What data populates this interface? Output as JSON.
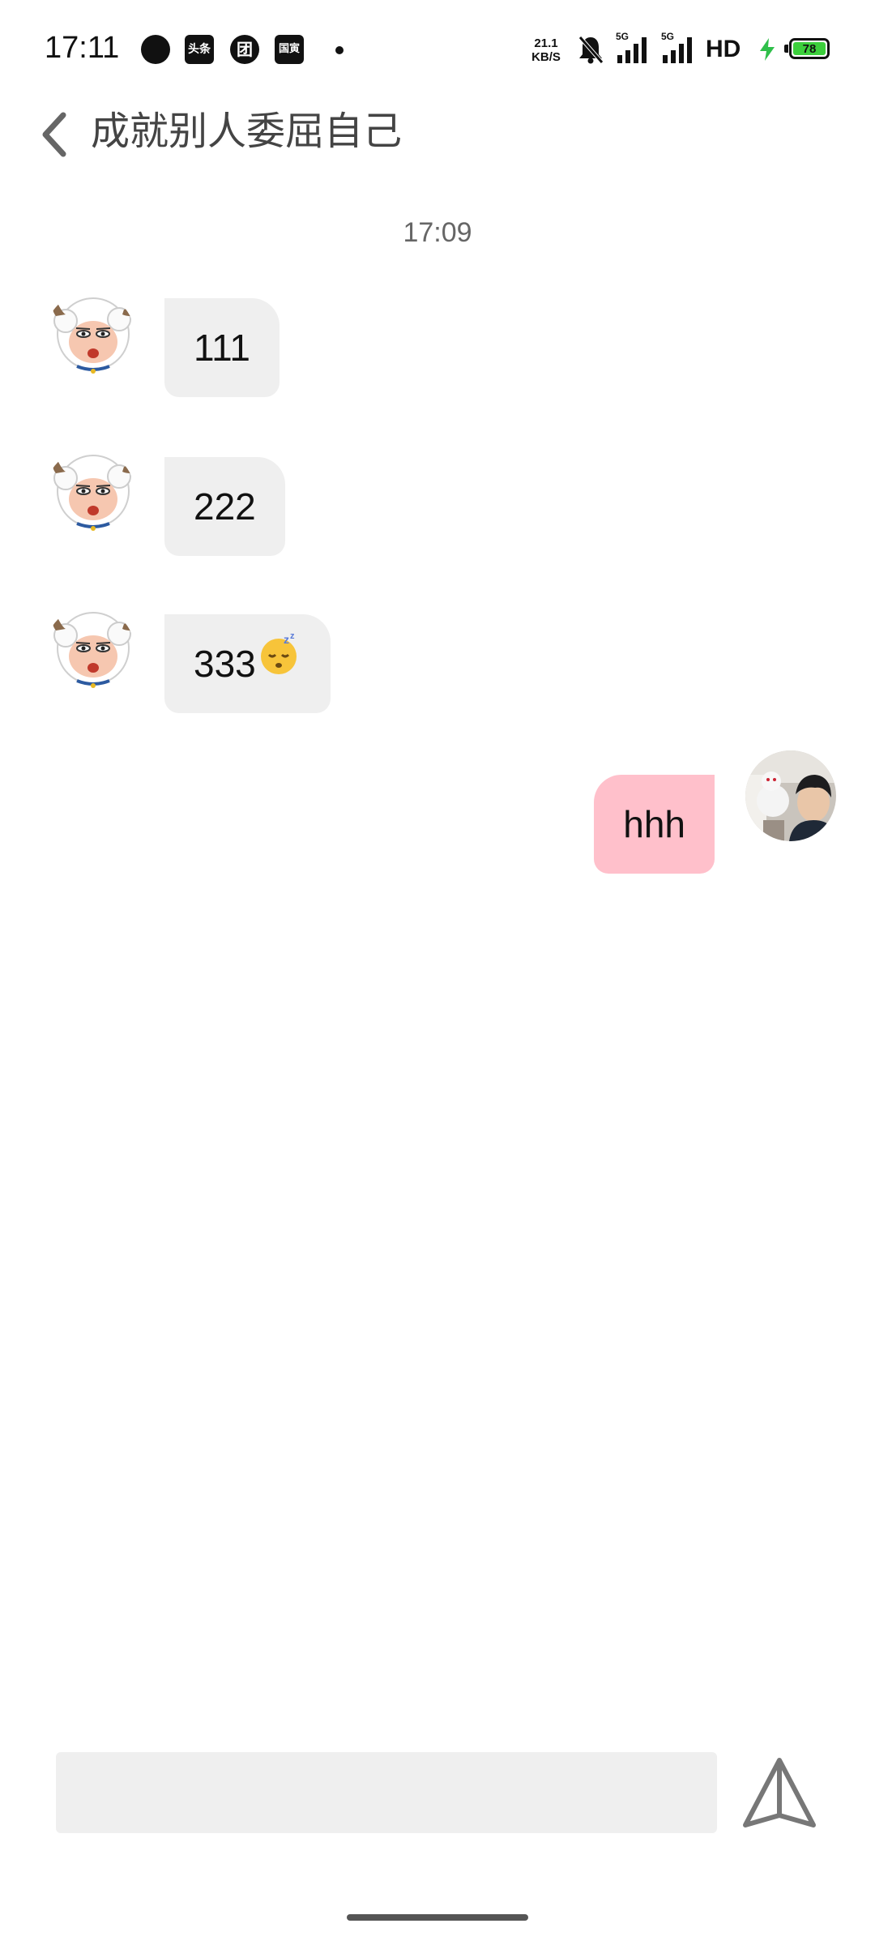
{
  "status_bar": {
    "time": "17:11",
    "app_icons": [
      {
        "icon": "chat-bubble-icon",
        "text": ""
      },
      {
        "icon": "toutiao-news-icon",
        "text": "头条"
      },
      {
        "icon": "meituan-icon",
        "text": "团"
      },
      {
        "icon": "news-app-icon",
        "text": "国寅"
      }
    ],
    "net_speed_value": "21.1",
    "net_speed_unit": "KB/S",
    "sim1_label": "5G",
    "sim2_label": "5G",
    "hd_label": "HD",
    "battery_level": "78",
    "battery_color": "#3ccf3c",
    "charging_color": "#2fbf4a"
  },
  "header": {
    "back_icon": "chevron-left-icon",
    "title": "成就别人委屈自己"
  },
  "chat": {
    "timestamp": "17:09",
    "messages": [
      {
        "direction": "incoming",
        "text": "111",
        "emoji": ""
      },
      {
        "direction": "incoming",
        "text": "222",
        "emoji": ""
      },
      {
        "direction": "incoming",
        "text": "333",
        "emoji": "😴"
      },
      {
        "direction": "outgoing",
        "text": "hhh",
        "emoji": ""
      }
    ],
    "incoming_bubble_color": "#efefef",
    "outgoing_bubble_color": "#ffc0cb"
  },
  "input_bar": {
    "placeholder": "",
    "value": "",
    "send_icon": "send-triangle-icon"
  }
}
